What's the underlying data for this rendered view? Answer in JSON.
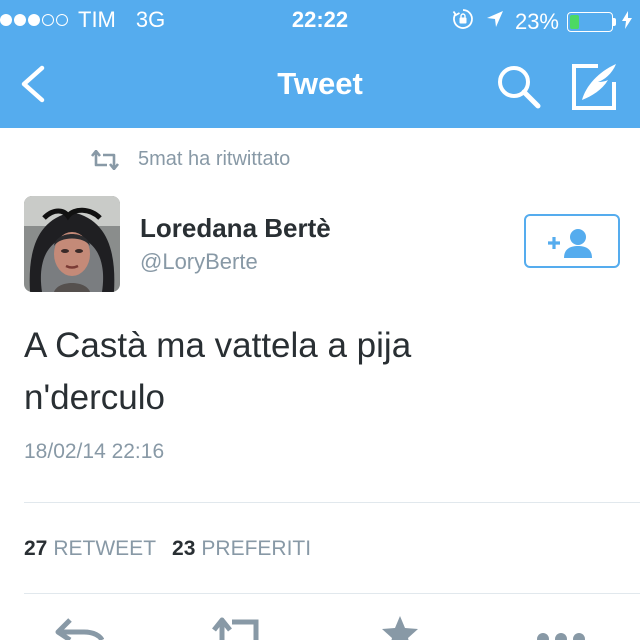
{
  "status_bar": {
    "carrier": "TIM",
    "network": "3G",
    "time": "22:22",
    "battery_percent": "23%",
    "battery_level": 0.23,
    "signal_bars_filled": 3,
    "signal_bars_total": 5,
    "icons": [
      "rotation-lock-icon",
      "location-arrow-icon",
      "charging-bolt-icon"
    ]
  },
  "nav": {
    "title": "Tweet",
    "back_icon": "chevron-left-icon",
    "search_icon": "search-icon",
    "compose_icon": "compose-icon"
  },
  "retweet_context": {
    "text": "5mat ha ritwittato",
    "icon": "retweet-icon"
  },
  "tweet": {
    "author_name": "Loredana Bertè",
    "author_handle": "@LoryBerte",
    "text_line1": "A Castà ma vattela a pija",
    "text_line2": "n'derculo",
    "timestamp": "18/02/14 22:16",
    "follow_icon": "add-user-icon"
  },
  "stats": {
    "retweets_count": "27",
    "retweets_label": "RETWEET",
    "favorites_count": "23",
    "favorites_label": "PREFERITI"
  },
  "actions": [
    "reply-icon",
    "retweet-icon",
    "favorite-icon",
    "more-icon"
  ],
  "colors": {
    "brand_blue": "#55acee",
    "text_dark": "#292f33",
    "text_gray": "#8899a6",
    "divider": "#e1e8ed",
    "battery_green": "#4cd964"
  }
}
